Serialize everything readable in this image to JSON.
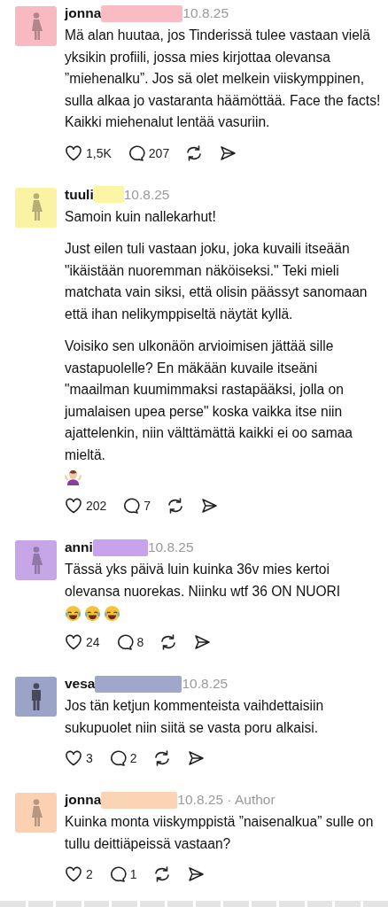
{
  "comments": [
    {
      "name": "jonna",
      "avatar": {
        "kind": "female",
        "color": "#f8b9c1"
      },
      "redaction": {
        "color": "#f9bcc4"
      },
      "date": "10.8.25",
      "paragraphs": [
        {
          "text": "Mä alan huutaa, jos Tinderissä tulee vastaan vielä yksikin profiili, jossa mies kirjottaa olevansa ”miehenalku”. Jos sä olet melkein viiskymppinen, sulla alkaa jo vastaranta häämöttää. Face the facts! Kaikki miehenalut lentää vasuriin."
        }
      ],
      "likes": "1,5K",
      "replies": "207"
    },
    {
      "name": "tuuli",
      "avatar": {
        "kind": "female",
        "color": "#fbf3a4"
      },
      "redaction": {
        "color": "#fcf5a6"
      },
      "date": "10.8.25",
      "paragraphs": [
        {
          "text": "Samoin kuin nallekarhut!"
        },
        {
          "text": "Just eilen tuli vastaan joku, joka kuvaili itseään \"ikäistään nuoremman näköiseksi.\" Teki mieli matchata vain siksi, että olisin päässyt sanomaan että ihan nelikymppiseltä näytät kyllä."
        },
        {
          "text": "Voisiko sen ulkonäön arvioimisen jättää sille vastapuolelle? En mäkään kuvaile itseäni \"maailman kuumimmaksi rastapääksi, jolla on jumalaisen upea perse\" koska vaikka itse niin ajattelenkin, niin välttämättä kaikki ei oo samaa mieltä.",
          "emoji": [
            {
              "kind": "shrug"
            }
          ]
        }
      ],
      "likes": "202",
      "replies": "7"
    },
    {
      "name": "anni",
      "avatar": {
        "kind": "female",
        "color": "#c6a6e6"
      },
      "redaction": {
        "color": "#c8a2ea"
      },
      "date": "10.8.25",
      "paragraphs": [
        {
          "text": "Tässä yks päivä luin kuinka 36v mies kertoi olevansa nuorekas. Niinku wtf 36 ON NUORI",
          "emoji": [
            {
              "kind": "laugh"
            },
            {
              "kind": "laugh"
            },
            {
              "kind": "laugh"
            }
          ]
        }
      ],
      "likes": "24",
      "replies": "8"
    },
    {
      "name": "vesa",
      "avatar": {
        "kind": "male",
        "color": "#9ba3c9"
      },
      "redaction": {
        "color": "#9fa7cd"
      },
      "date": "10.8.25",
      "paragraphs": [
        {
          "text": "Jos tän ketjun kommenteista vaihdettaisiin sukupuolet niin siitä se vasta poru alkaisi."
        }
      ],
      "likes": "3",
      "replies": "2"
    },
    {
      "name": "jonna",
      "avatar": {
        "kind": "female",
        "color": "#fbd1b2"
      },
      "redaction": {
        "color": "#fbd3b5"
      },
      "date": "10.8.25 · Author",
      "paragraphs": [
        {
          "text": "Kuinka monta viiskymppistä ”naisenalkua” sulle on tullu deittiäpeissä vastaan?"
        }
      ],
      "likes": "2",
      "replies": "1"
    }
  ]
}
